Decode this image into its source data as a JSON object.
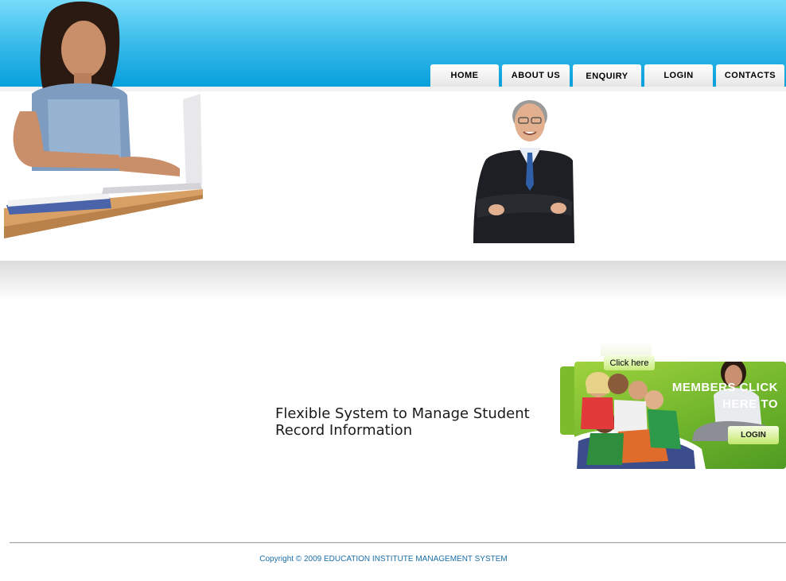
{
  "nav": {
    "home": "HOME",
    "about": "ABOUT US",
    "enquiry": "ENQUIRY",
    "login": "LOGIN",
    "contacts": "CONTACTS"
  },
  "tagline": {
    "line1": "Flexible System to Manage Student",
    "line2": "Record Information"
  },
  "promo": {
    "click_here": "Click here",
    "members_line1": "MEMBERS CLICK",
    "members_line2": "HERE TO",
    "login_button": "LOGIN"
  },
  "footer": {
    "copyright": "Copyright © 2009 EDUCATION INSTITUTE MANAGEMENT SYSTEM"
  },
  "colors": {
    "header_blue": "#08a0dc",
    "promo_green": "#6cb22a",
    "footer_text": "#1a6ea8"
  }
}
